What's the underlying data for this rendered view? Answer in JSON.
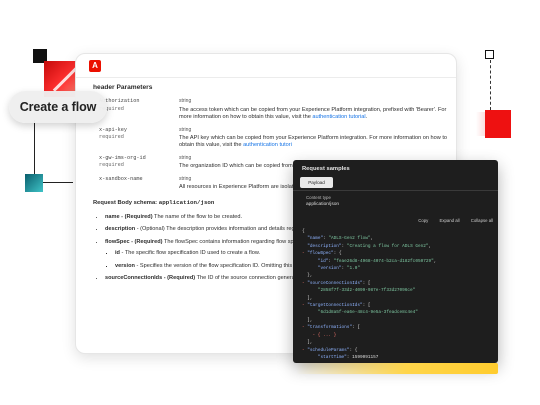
{
  "hero": {
    "pill_label": "Create a flow"
  },
  "doc": {
    "logo": "A",
    "section_title": "header Parameters",
    "params": [
      {
        "name": "Authorization",
        "required": "required",
        "type": "string",
        "desc_pre": "The access token which can be copied from your Experience Platform integration, prefixed with 'Bearer'. For more information on how to obtain this value, visit the ",
        "link": "authentication tutorial",
        "desc_post": "."
      },
      {
        "name": "x-api-key",
        "required": "required",
        "type": "string",
        "desc_pre": "The API key which can be copied from your Experience Platform integration. For more information on how to obtain this value, visit the ",
        "link": "authentication tutori",
        "desc_post": ""
      },
      {
        "name": "x-gw-ims-org-id",
        "required": "required",
        "type": "string",
        "desc_pre": "The organization ID which can be copied from how to obtain this value, visit the ",
        "link": "authenticati",
        "desc_post": ""
      },
      {
        "name": "x-sandbox-name",
        "required": "",
        "type": "string",
        "desc_pre": "All resources in Experience Platform are isolat require a header that specifies the name of th",
        "link": "",
        "desc_post": ""
      }
    ],
    "schema_label": "Request Body schema:",
    "schema_value": "application/json",
    "body_items": [
      {
        "name": "name",
        "req": " - (Required)",
        "desc": " The name of the flow to be created."
      },
      {
        "name": "description",
        "req": " - (Optional)",
        "desc": " The description provides information and details rega"
      },
      {
        "name": "flowSpec",
        "req": " - (Required)",
        "desc": " The flowSpec contains information regarding flow spec"
      }
    ],
    "flowspec_sub": [
      {
        "name": "id",
        "desc": " - The specific flow specification ID used to create a flow."
      },
      {
        "name": "version",
        "desc": " - Specifies the version of the flow specification ID. Omitting this v"
      }
    ],
    "source_item": {
      "name": "sourceConnectionIds",
      "req": " - (Required)",
      "desc": " The ID of the source connection generated specification IDs."
    }
  },
  "samples": {
    "title": "Request samples",
    "tab": "Payload",
    "content_type_label": "Content type",
    "content_type_value": "application/json",
    "actions": [
      "Copy",
      "Expand all",
      "Collapse all"
    ],
    "code_lines": [
      "{",
      "  \"name\": \"ADLS-Gen2 flow\",",
      "  \"description\": \"Creating a flow for ADLS Gen2\",",
      "- \"flowSpec\": {",
      "      \"id\": \"feae26d8-4968-4074-b2ca-d182fc050729\",",
      "      \"version\": \"1.0\"",
      "  },",
      "- \"sourceConnectionIds\": [",
      "      \"2858f7f-33d2-4099-987e-7f33d27096ce\"",
      "  ],",
      "- \"targetConnectionIds\": [",
      "      \"6d1d8a5f-ea6e-48c4-9e5a-3feadce8c4e4\"",
      "  ],",
      "- \"transformations\": [",
      "    - { ... }",
      "  ],",
      "- \"scheduleParams\": {",
      "      \"startTime\": 1599091157"
    ]
  }
}
